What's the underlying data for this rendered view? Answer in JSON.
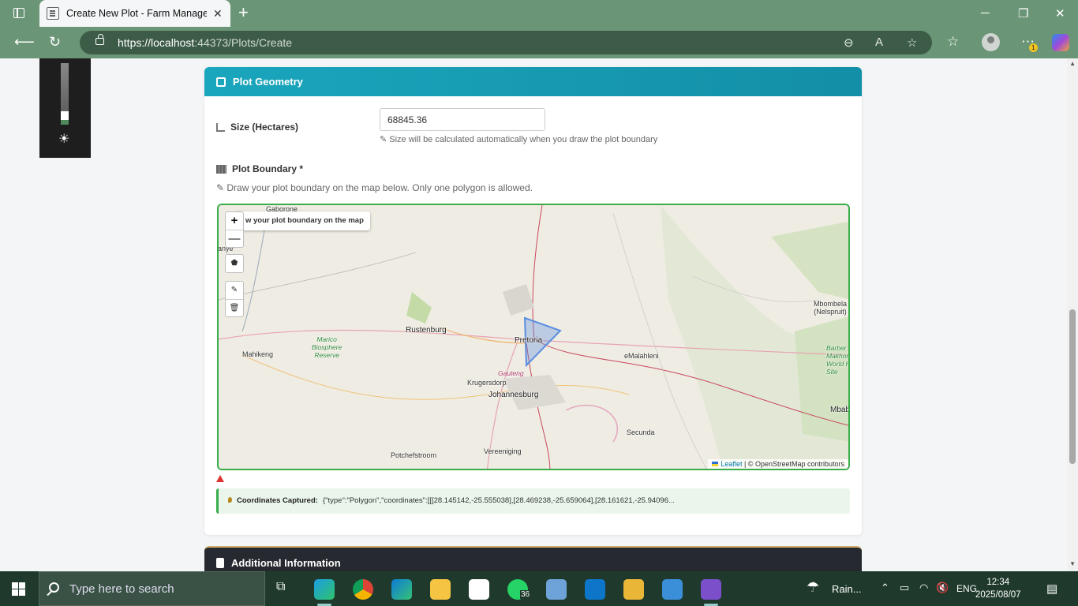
{
  "browser": {
    "tab_title": "Create New Plot - Farm Managem",
    "url_host": "https://localhost",
    "url_path": ":44373/Plots/Create",
    "new_tab": "+",
    "close": "✕"
  },
  "section": {
    "title": "Plot Geometry",
    "size_label": "Size (Hectares)",
    "size_value": "68845.36",
    "size_help": "Size will be calculated automatically when you draw the plot boundary",
    "boundary_label": "Plot Boundary *",
    "boundary_help": "Draw your plot boundary on the map below. Only one polygon is allowed."
  },
  "map": {
    "tooltip": "w your plot boundary on the map",
    "zoom_in": "+",
    "zoom_out": "—",
    "attribution_leaflet": "Leaflet",
    "attribution_osm": "| © OpenStreetMap contributors",
    "places": {
      "gaborone": "Gaborone",
      "anye": "anye",
      "rustenburg": "Rustenburg",
      "pretoria": "Pretoria",
      "mahikeng": "Mahikeng",
      "marico": "Marico",
      "biosphere": "Biosphere",
      "reserve": "Reserve",
      "gauteng": "Gauteng",
      "krugersdorp": "Krugersdorp",
      "johannesburg": "Johannesburg",
      "emalahleni": "eMalahleni",
      "mbombela": "Mbombela",
      "nelspruit": "(Nelspruit)",
      "barberton1": "Barber",
      "barberton2": "Makhon",
      "barberton3": "World He",
      "barberton4": "Site",
      "mbab": "Mbab",
      "secunda": "Secunda",
      "potchefstroom": "Potchefstroom",
      "vereeniging": "Vereeniging"
    },
    "polygon_color": "#5b8fe0"
  },
  "coordinates": {
    "label": "Coordinates Captured:",
    "value": "{\"type\":\"Polygon\",\"coordinates\":[[[28.145142,-25.555038],[28.469238,-25.659064],[28.161621,-25.94096..."
  },
  "next_section": {
    "title": "Additional Information"
  },
  "taskbar": {
    "search_placeholder": "Type here to search",
    "whatsapp_badge": "36",
    "weather": "Rain...",
    "language": "ENG",
    "time": "12:34",
    "date": "2025/08/07"
  },
  "colors": {
    "header_teal": "#1aa6bd",
    "map_border_green": "#3aad4a",
    "browser_green": "#6a9577"
  }
}
